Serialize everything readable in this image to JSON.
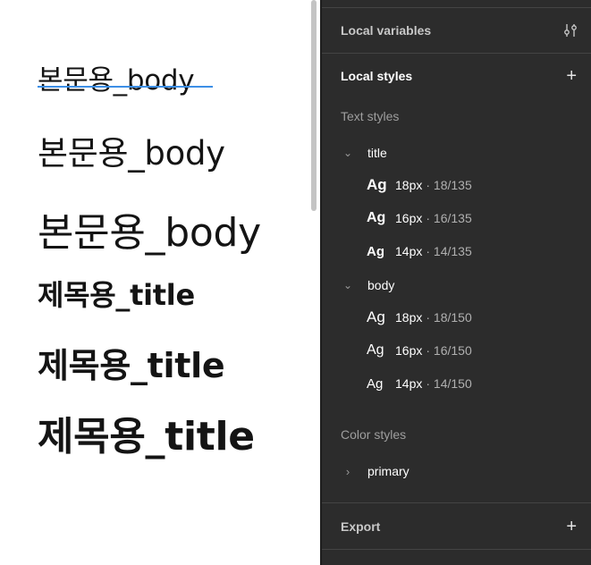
{
  "canvas": {
    "samples": [
      {
        "text": "본문용_body"
      },
      {
        "text": "본문용_body"
      },
      {
        "text": "본문용_body"
      },
      {
        "text": "제목용_title"
      },
      {
        "text": "제목용_title"
      },
      {
        "text": "제목용_title"
      }
    ]
  },
  "panel": {
    "local_variables": {
      "label": "Local variables",
      "icon": "adjust-icon"
    },
    "local_styles": {
      "label": "Local styles",
      "action_icon": "plus-icon"
    },
    "text_styles": {
      "label": "Text styles",
      "groups": [
        {
          "name": "title",
          "expanded": true,
          "items": [
            {
              "preview": "Ag",
              "name": "18px",
              "meta": "· 18/135"
            },
            {
              "preview": "Ag",
              "name": "16px",
              "meta": "· 16/135"
            },
            {
              "preview": "Ag",
              "name": "14px",
              "meta": "· 14/135"
            }
          ]
        },
        {
          "name": "body",
          "expanded": true,
          "items": [
            {
              "preview": "Ag",
              "name": "18px",
              "meta": "· 18/150"
            },
            {
              "preview": "Ag",
              "name": "16px",
              "meta": "· 16/150"
            },
            {
              "preview": "Ag",
              "name": "14px",
              "meta": "· 14/150"
            }
          ]
        }
      ]
    },
    "color_styles": {
      "label": "Color styles",
      "groups": [
        {
          "name": "primary",
          "expanded": false
        }
      ]
    },
    "export": {
      "label": "Export",
      "action_icon": "plus-icon"
    }
  },
  "colors": {
    "panel_bg": "#2c2c2c",
    "selection": "#3d8fe6",
    "canvas_text": "#141414"
  }
}
